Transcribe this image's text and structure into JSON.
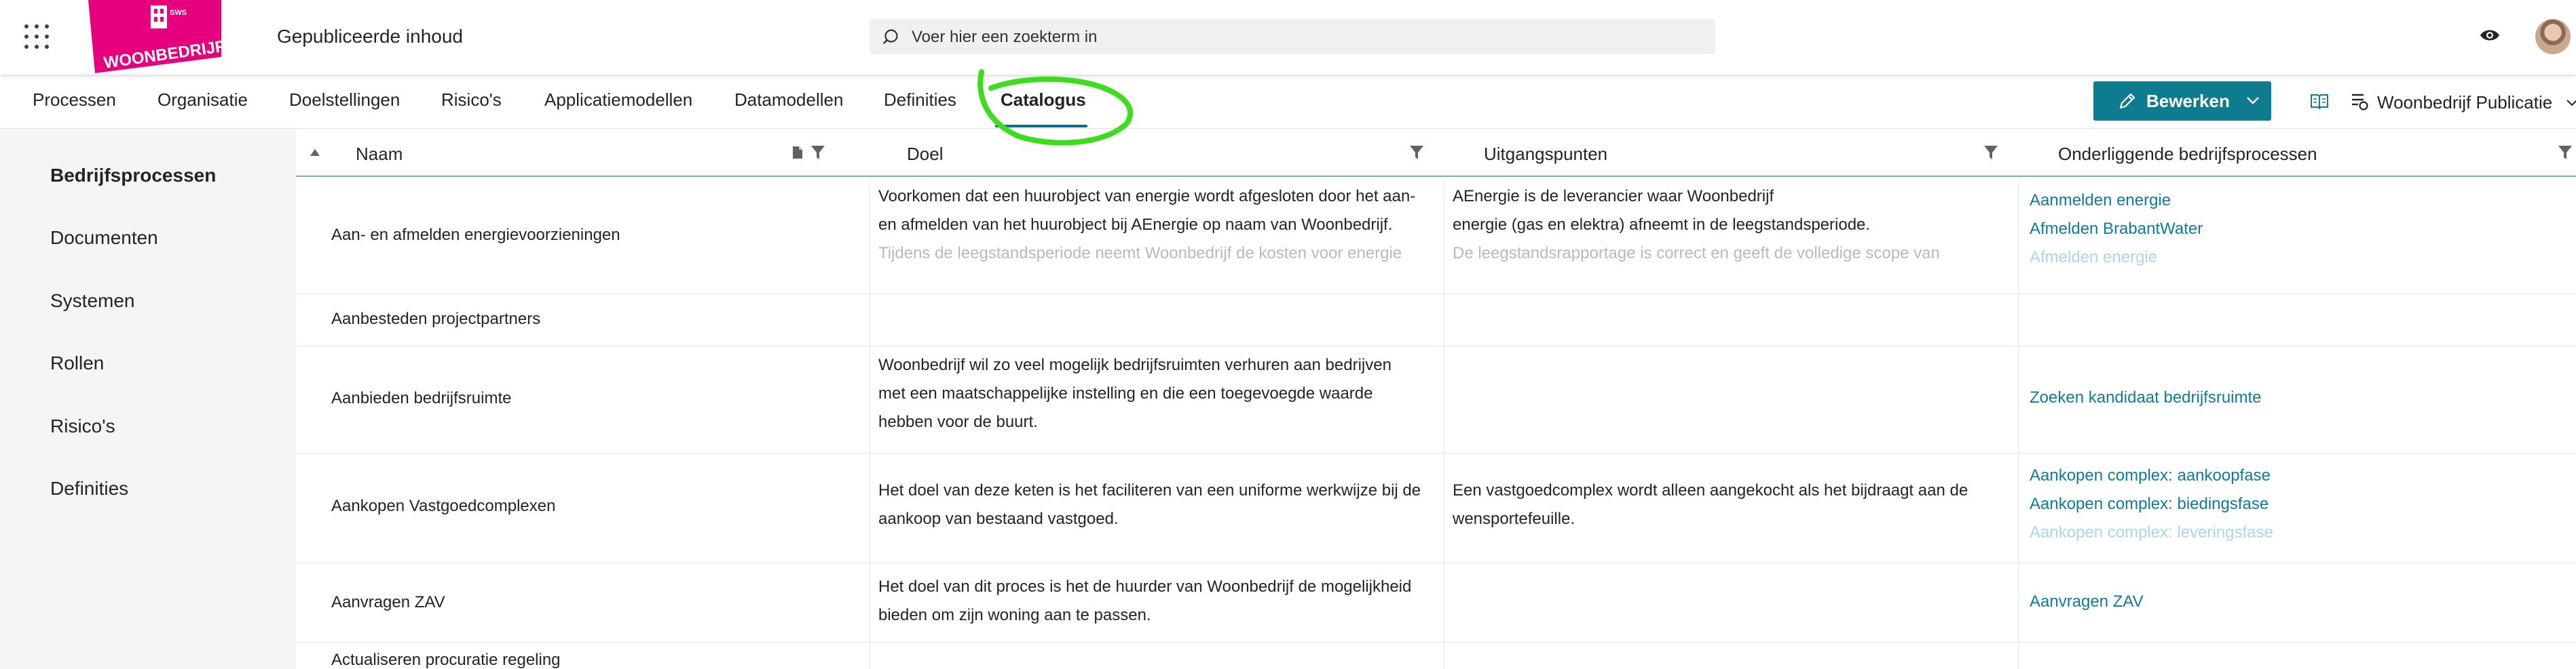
{
  "header": {
    "app_title": "Gepubliceerde inhoud",
    "logo_text": "WOONBEDRIJF",
    "logo_small": "SWS",
    "search_placeholder": "Voer hier een zoekterm in"
  },
  "nav": {
    "tabs": [
      {
        "label": "Processen"
      },
      {
        "label": "Organisatie"
      },
      {
        "label": "Doelstellingen"
      },
      {
        "label": "Risico's"
      },
      {
        "label": "Applicatiemodellen"
      },
      {
        "label": "Datamodellen"
      },
      {
        "label": "Definities"
      },
      {
        "label": "Catalogus",
        "active": true
      }
    ],
    "edit_label": "Bewerken",
    "publication_label": "Woonbedrijf Publicatie"
  },
  "sidebar": {
    "items": [
      {
        "label": "Bedrijfsprocessen",
        "active": true
      },
      {
        "label": "Documenten"
      },
      {
        "label": "Systemen"
      },
      {
        "label": "Rollen"
      },
      {
        "label": "Risico's"
      },
      {
        "label": "Definities"
      }
    ]
  },
  "table": {
    "columns": [
      {
        "label": "Naam"
      },
      {
        "label": "Doel"
      },
      {
        "label": "Uitgangspunten"
      },
      {
        "label": "Onderliggende bedrijfsprocessen"
      }
    ],
    "rows": [
      {
        "name": "Aan- en afmelden energievoorzieningen",
        "doel": [
          "Voorkomen dat een huurobject van energie wordt afgesloten door het aan-",
          "en afmelden van het huurobject bij AEnergie op naam van Woonbedrijf.",
          "Tijdens de leegstandsperiode neemt Woonbedrijf de kosten voor energie"
        ],
        "uitgangspunten": [
          "AEnergie is de leverancier waar Woonbedrijf",
          "energie (gas en elektra) afneemt in de leegstandsperiode.",
          "De leegstandsrapportage is correct en geeft de volledige scope van"
        ],
        "processen": [
          "Aanmelden energie",
          "Afmelden BrabantWater",
          "Afmelden energie"
        ]
      },
      {
        "name": "Aanbesteden projectpartners",
        "doel": [],
        "uitgangspunten": [],
        "processen": []
      },
      {
        "name": "Aanbieden bedrijfsruimte",
        "doel": [
          "Woonbedrijf wil zo veel mogelijk bedrijfsruimten verhuren aan bedrijven",
          "met een maatschappelijke instelling en die een toegevoegde waarde",
          "hebben voor de buurt."
        ],
        "uitgangspunten": [],
        "processen": [
          "Zoeken kandidaat bedrijfsruimte"
        ]
      },
      {
        "name": "Aankopen Vastgoedcomplexen",
        "doel": [
          "Het doel van deze keten is het faciliteren van een uniforme werkwijze bij de",
          "aankoop van bestaand vastgoed."
        ],
        "uitgangspunten": [
          "Een vastgoedcomplex wordt alleen aangekocht als het bijdraagt aan de",
          "wensportefeuille."
        ],
        "processen": [
          "Aankopen complex: aankoopfase",
          "Aankopen complex: biedingsfase",
          "Aankopen complex: leveringsfase"
        ]
      },
      {
        "name": "Aanvragen ZAV",
        "doel": [
          "Het doel van dit proces is het de huurder van Woonbedrijf de mogelijkheid",
          "bieden om zijn woning aan te passen."
        ],
        "uitgangspunten": [],
        "processen": [
          "Aanvragen ZAV"
        ]
      },
      {
        "name": "Actualiseren procuratie regeling",
        "doel": [],
        "uitgangspunten": [],
        "processen": []
      }
    ]
  },
  "colors": {
    "accent": "#0f7b8f",
    "link": "#0f7b9a",
    "logo": "#e6007e",
    "annotation": "#3ddc1e"
  }
}
